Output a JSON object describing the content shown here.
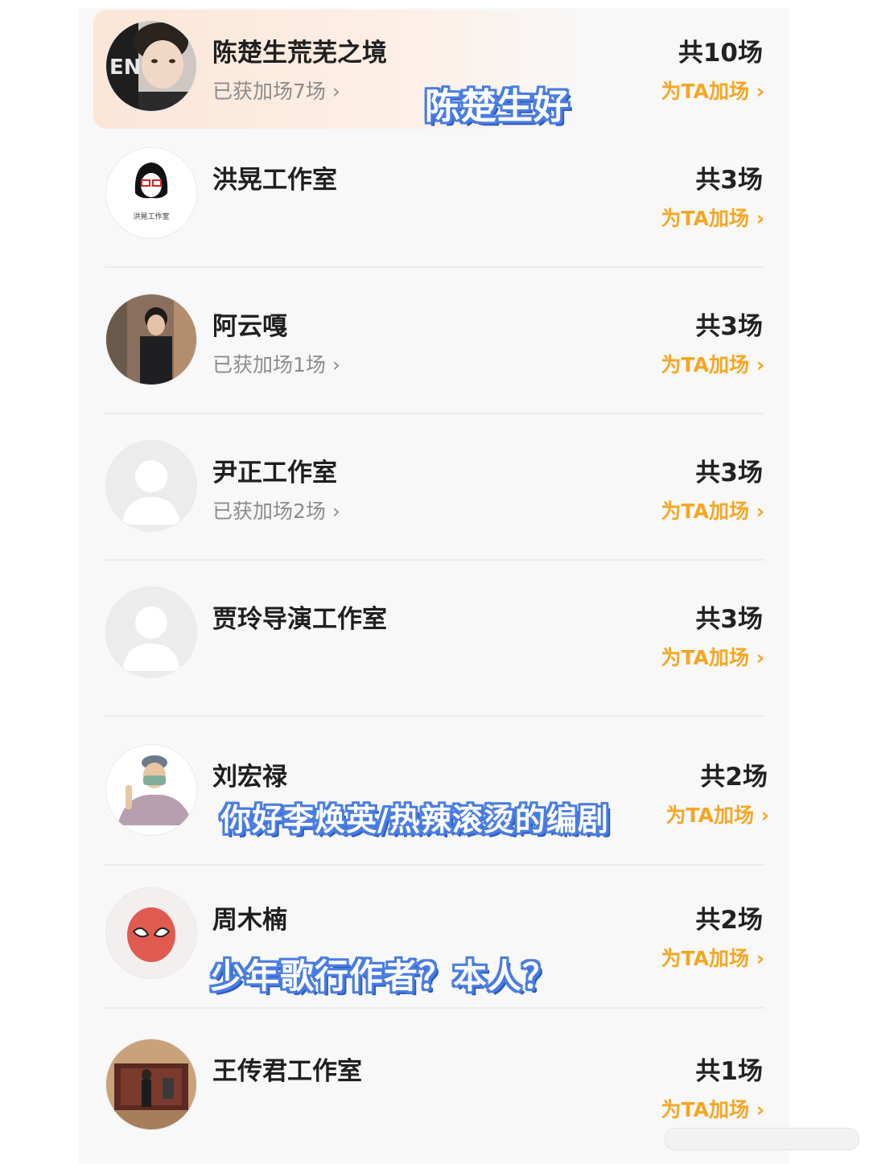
{
  "items": [
    {
      "name": "陈楚生荒芜之境",
      "gained": "已获加场7场 ›",
      "total": "共10场",
      "add": "为TA加场 ›",
      "avatar_icon": "person-photo-icon"
    },
    {
      "name": "洪晃工作室",
      "gained": "",
      "total": "共3场",
      "add": "为TA加场 ›",
      "avatar_icon": "studio-logo-icon",
      "logo_text": "洪晃工作室"
    },
    {
      "name": "阿云嘎",
      "gained": "已获加场1场 ›",
      "total": "共3场",
      "add": "为TA加场 ›",
      "avatar_icon": "person-photo-icon"
    },
    {
      "name": "尹正工作室",
      "gained": "已获加场2场 ›",
      "total": "共3场",
      "add": "为TA加场 ›",
      "avatar_icon": "default-avatar-icon"
    },
    {
      "name": "贾玲导演工作室",
      "gained": "",
      "total": "共3场",
      "add": "为TA加场 ›",
      "avatar_icon": "default-avatar-icon"
    },
    {
      "name": "刘宏禄",
      "gained": "",
      "total": "共2场",
      "add": "为TA加场 ›",
      "avatar_icon": "cartoon-avatar-icon"
    },
    {
      "name": "周木楠",
      "gained": "",
      "total": "共2场",
      "add": "为TA加场 ›",
      "avatar_icon": "spiderman-avatar-icon"
    },
    {
      "name": "王传君工作室",
      "gained": "",
      "total": "共1场",
      "add": "为TA加场 ›",
      "avatar_icon": "stage-photo-icon"
    }
  ],
  "overlays": {
    "first": "陈楚生好",
    "second": "你好李焕英/热辣滚烫的编剧",
    "third": "少年歌行作者？本人？"
  },
  "colors": {
    "accent": "#f5a623",
    "overlay_stroke": "#4a7de0",
    "highlight": "#fbe6d8"
  }
}
